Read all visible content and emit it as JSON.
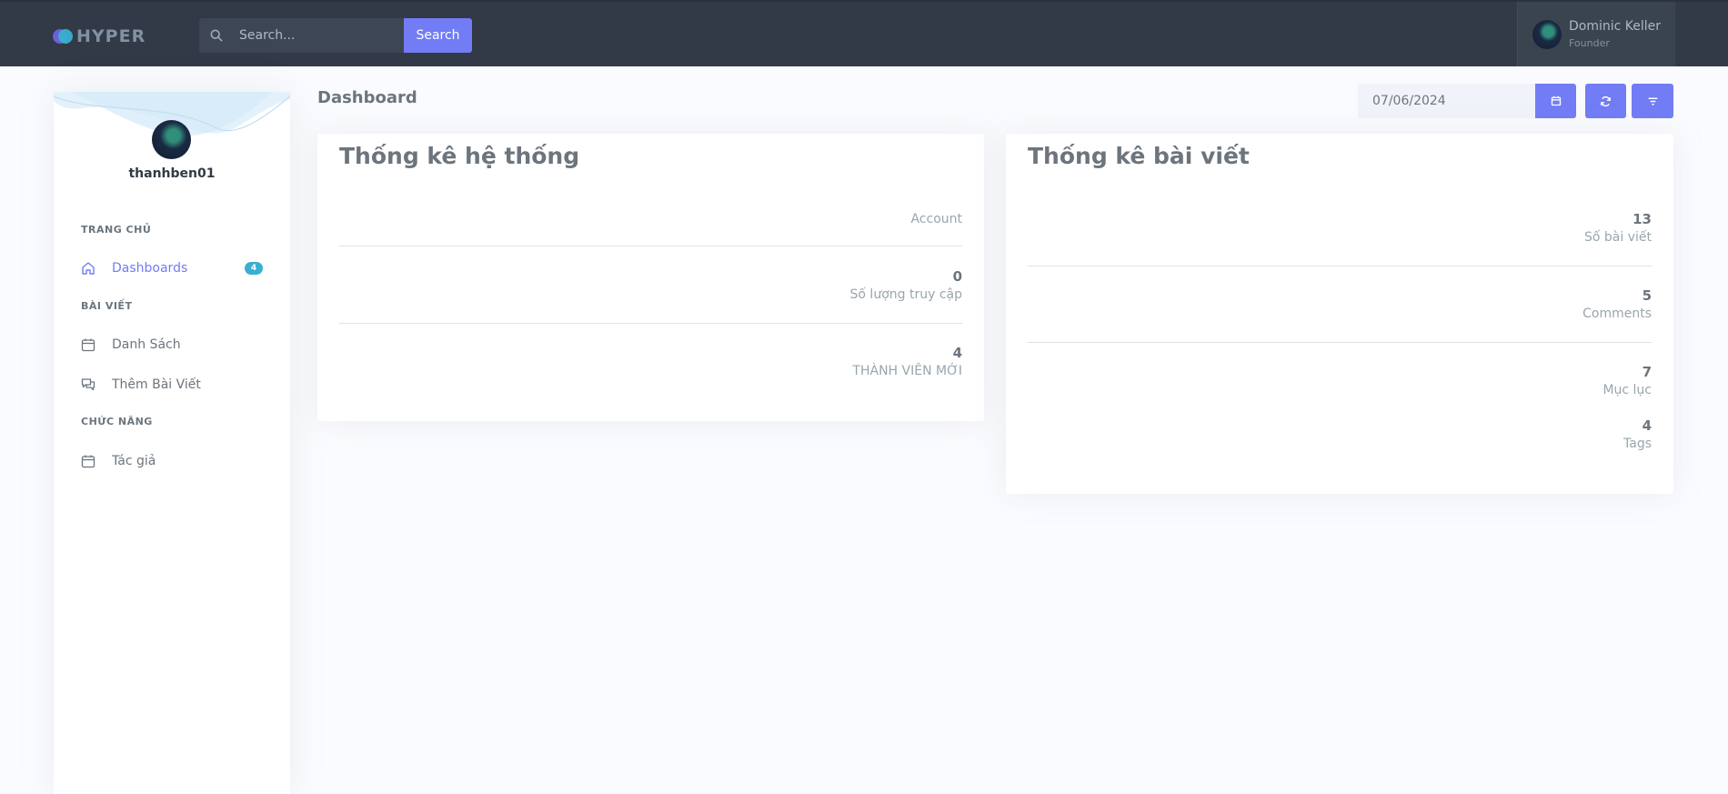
{
  "brand": {
    "name": "HYPER"
  },
  "search": {
    "placeholder": "Search...",
    "button_label": "Search"
  },
  "user": {
    "name": "Dominic Keller",
    "role": "Founder"
  },
  "sidebar": {
    "username": "thanhben01",
    "sections": [
      {
        "title": "TRANG CHỦ"
      },
      {
        "title": "BÀI VIẾT"
      },
      {
        "title": "CHỨC NĂNG"
      }
    ],
    "items": [
      {
        "label": "Dashboards",
        "badge": "4",
        "icon": "home-icon"
      },
      {
        "label": "Danh Sách",
        "icon": "calendar-icon"
      },
      {
        "label": "Thêm Bài Viết",
        "icon": "chat-icon"
      },
      {
        "label": "Tác giả",
        "icon": "calendar-icon"
      }
    ]
  },
  "page": {
    "title": "Dashboard",
    "date_value": "07/06/2024"
  },
  "system_stats": {
    "title": "Thống kê hệ thống",
    "rows": [
      {
        "value": "",
        "label": "Account"
      },
      {
        "value": "0",
        "label": "Số lượng truy cập"
      },
      {
        "value": "4",
        "label": "THÀNH VIÊN MỚI"
      }
    ]
  },
  "post_stats": {
    "title": "Thống kê bài viết",
    "rows": [
      {
        "value": "13",
        "label": "Số bài viết"
      },
      {
        "value": "5",
        "label": "Comments"
      },
      {
        "value": "7",
        "label": "Mục lục"
      },
      {
        "value": "4",
        "label": "Tags"
      }
    ]
  },
  "colors": {
    "primary": "#727cf5",
    "topbar": "#313a46",
    "info": "#39afd1"
  }
}
